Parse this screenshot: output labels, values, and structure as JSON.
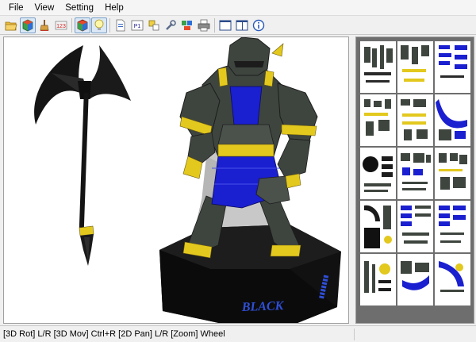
{
  "menu": {
    "items": [
      {
        "label": "File"
      },
      {
        "label": "View"
      },
      {
        "label": "Setting"
      },
      {
        "label": "Help"
      }
    ]
  },
  "toolbar": {
    "buttons": [
      {
        "icon": "open-folder-icon",
        "active": false
      },
      {
        "icon": "3d-view-icon",
        "active": true
      },
      {
        "icon": "brush-icon",
        "active": false
      },
      {
        "icon": "edge-id-icon",
        "active": false
      },
      {
        "icon": "texture-3d-icon",
        "active": true
      },
      {
        "icon": "lightbulb-icon",
        "active": true
      },
      {
        "icon": "page-setup-icon",
        "active": false
      },
      {
        "icon": "page-number-icon",
        "active": false
      },
      {
        "icon": "pieces-icon",
        "active": false
      },
      {
        "icon": "tools-icon",
        "active": false
      },
      {
        "icon": "unfold-icon",
        "active": false
      },
      {
        "icon": "print-icon",
        "active": false
      },
      {
        "icon": "single-pane-icon",
        "active": false
      },
      {
        "icon": "dual-pane-icon",
        "active": false
      },
      {
        "icon": "info-icon",
        "active": false
      }
    ],
    "badge_text": "P1"
  },
  "model": {
    "base_text": "BLACK"
  },
  "status": {
    "text": "[3D Rot] L/R [3D Mov] Ctrl+R [2D Pan] L/R [Zoom] Wheel"
  },
  "colors": {
    "armor": "#3e453f",
    "trim": "#e3c81e",
    "cloth": "#1a1fd0",
    "cape": "#c8c8c8",
    "base": "#111111",
    "text_blue": "#2f4fd8",
    "sheet_bg": "#6e6e6e"
  }
}
